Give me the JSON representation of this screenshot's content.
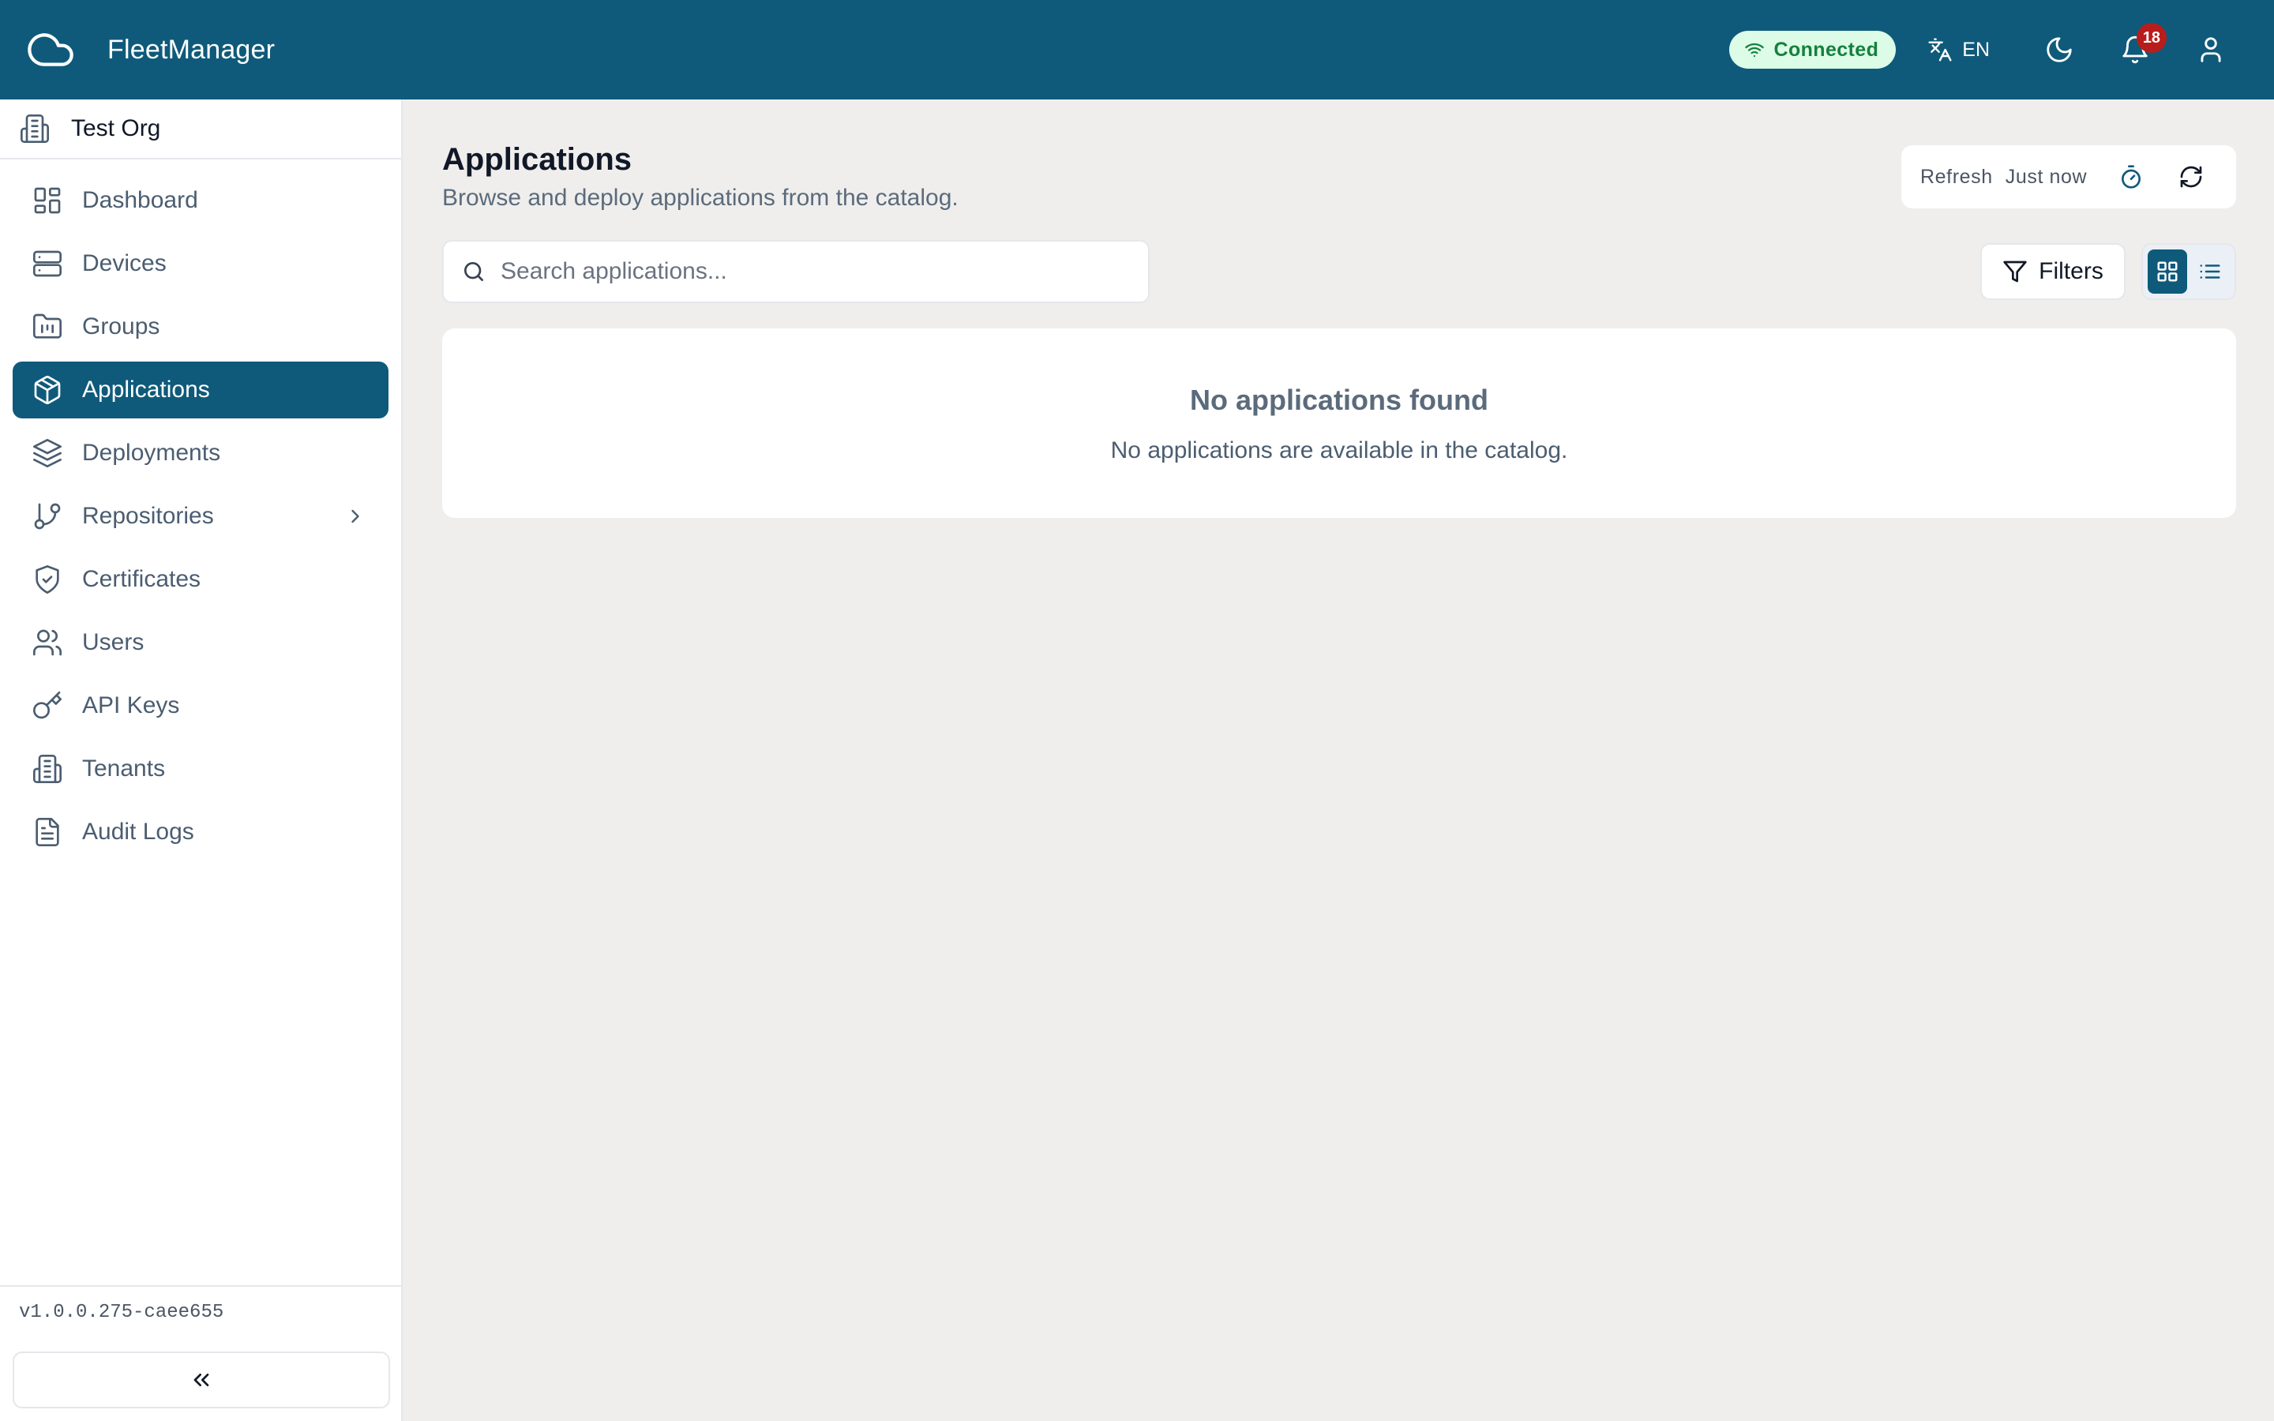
{
  "app": {
    "title": "FleetManager",
    "logo_icon": "cloud-icon"
  },
  "header": {
    "status": {
      "label": "Connected",
      "icon": "wifi-icon",
      "color": "#15803d",
      "background": "#dcfce7"
    },
    "language": {
      "label": "EN",
      "icon": "translate-icon"
    },
    "theme_icon": "moon-icon",
    "notifications": {
      "count": "18",
      "icon": "bell-icon",
      "badge_color": "#b91c1c"
    },
    "user_icon": "user-icon"
  },
  "sidebar": {
    "org": {
      "name": "Test Org",
      "icon": "building-icon"
    },
    "items": [
      {
        "label": "Dashboard",
        "icon": "dashboard-icon",
        "active": false
      },
      {
        "label": "Devices",
        "icon": "server-icon",
        "active": false
      },
      {
        "label": "Groups",
        "icon": "folder-icon",
        "active": false
      },
      {
        "label": "Applications",
        "icon": "package-icon",
        "active": true
      },
      {
        "label": "Deployments",
        "icon": "layers-icon",
        "active": false
      },
      {
        "label": "Repositories",
        "icon": "git-branch-icon",
        "active": false,
        "expandable": true
      },
      {
        "label": "Certificates",
        "icon": "shield-check-icon",
        "active": false
      },
      {
        "label": "Users",
        "icon": "users-icon",
        "active": false
      },
      {
        "label": "API Keys",
        "icon": "key-icon",
        "active": false
      },
      {
        "label": "Tenants",
        "icon": "building-icon",
        "active": false
      },
      {
        "label": "Audit Logs",
        "icon": "file-text-icon",
        "active": false
      }
    ],
    "version": "v1.0.0.275-caee655",
    "collapse_icon": "chevrons-left-icon"
  },
  "page": {
    "title": "Applications",
    "subtitle": "Browse and deploy applications from the catalog.",
    "refresh": {
      "label": "Refresh",
      "time": "Just now"
    },
    "search": {
      "placeholder": "Search applications...",
      "value": ""
    },
    "filters_label": "Filters",
    "view_mode": "grid",
    "empty": {
      "title": "No applications found",
      "message": "No applications are available in the catalog."
    }
  },
  "colors": {
    "accent": "#0f5a7a",
    "background": "#efeeec",
    "surface": "#ffffff"
  }
}
